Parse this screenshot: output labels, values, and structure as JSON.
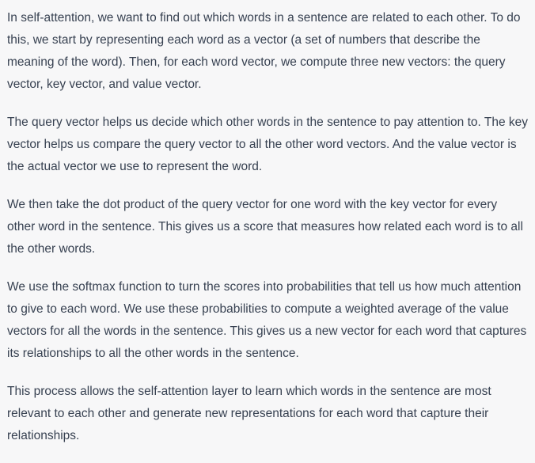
{
  "message": {
    "paragraphs": [
      "In self-attention, we want to find out which words in a sentence are related to each other. To do this, we start by representing each word as a vector (a set of numbers that describe the meaning of the word). Then, for each word vector, we compute three new vectors: the query vector, key vector, and value vector.",
      "The query vector helps us decide which other words in the sentence to pay attention to. The key vector helps us compare the query vector to all the other word vectors. And the value vector is the actual vector we use to represent the word.",
      "We then take the dot product of the query vector for one word with the key vector for every other word in the sentence. This gives us a score that measures how related each word is to all the other words.",
      "We use the softmax function to turn the scores into probabilities that tell us how much attention to give to each word. We use these probabilities to compute a weighted average of the value vectors for all the words in the sentence. This gives us a new vector for each word that captures its relationships to all the other words in the sentence.",
      "This process allows the self-attention layer to learn which words in the sentence are most relevant to each other and generate new representations for each word that capture their relationships."
    ]
  },
  "colors": {
    "background": "#f7f7f8",
    "text": "#374151"
  }
}
